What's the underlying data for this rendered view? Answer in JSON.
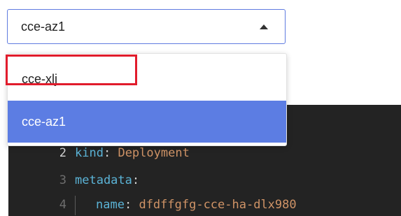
{
  "select": {
    "value": "cce-az1",
    "arrow_icon": "caret-up-icon"
  },
  "dropdown": {
    "options": [
      {
        "label": "cce-xlj",
        "selected": false
      },
      {
        "label": "cce-az1",
        "selected": true
      }
    ],
    "highlight_color": "#e11c2c",
    "selected_bg": "#5c7de3"
  },
  "editor": {
    "lines": [
      {
        "number": "2",
        "key": "kind",
        "sep": ":",
        "value": "Deployment"
      },
      {
        "number": "3",
        "key": "metadata",
        "sep": ":",
        "value": ""
      },
      {
        "number": "4",
        "key": "name",
        "sep": ":",
        "value": "dfdffgfg-cce-ha-dlx980"
      }
    ]
  }
}
